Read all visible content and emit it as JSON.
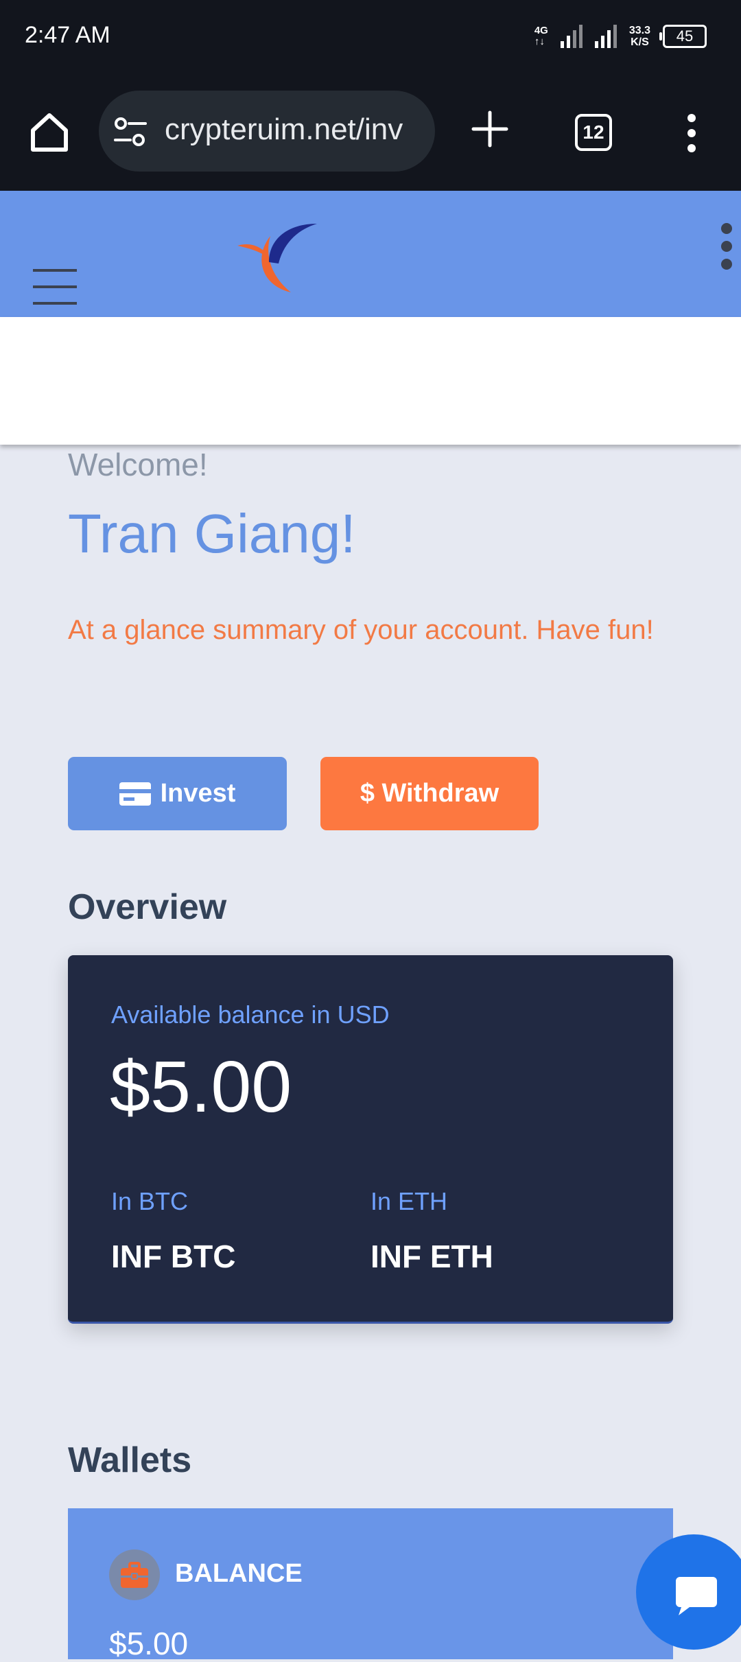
{
  "status_bar": {
    "time": "2:47 AM",
    "network_label": "4G",
    "data_arrows": "↑↓",
    "speed_value": "33.3",
    "speed_unit": "K/S",
    "battery": "45"
  },
  "browser": {
    "url": "crypteruim.net/inv",
    "tab_count": "12"
  },
  "site": {
    "brand_colors": {
      "header": "#6995e8",
      "accent": "#fd7840",
      "dark_card": "#212942"
    }
  },
  "dashboard": {
    "welcome": "Welcome!",
    "user_name": "Tran Giang!",
    "summary": "At a glance summary of your account. Have fun!",
    "invest_label": "Invest",
    "withdraw_label": "$ Withdraw"
  },
  "overview": {
    "heading": "Overview",
    "balance_label": "Available balance in USD",
    "balance_value": "$5.00",
    "btc_label": "In BTC",
    "btc_value": "INF BTC",
    "eth_label": "In ETH",
    "eth_value": "INF ETH"
  },
  "wallets": {
    "heading": "Wallets",
    "card_label": "BALANCE",
    "card_value": "$5.00"
  },
  "icons": {
    "home": "home-icon",
    "site_settings": "tune-icon",
    "new_tab": "plus-icon",
    "browser_menu": "more-vertical-icon",
    "site_menu": "hamburger-menu-icon",
    "invest": "credit-card-icon",
    "wallet": "briefcase-icon",
    "chat": "chat-bubble-icon"
  }
}
